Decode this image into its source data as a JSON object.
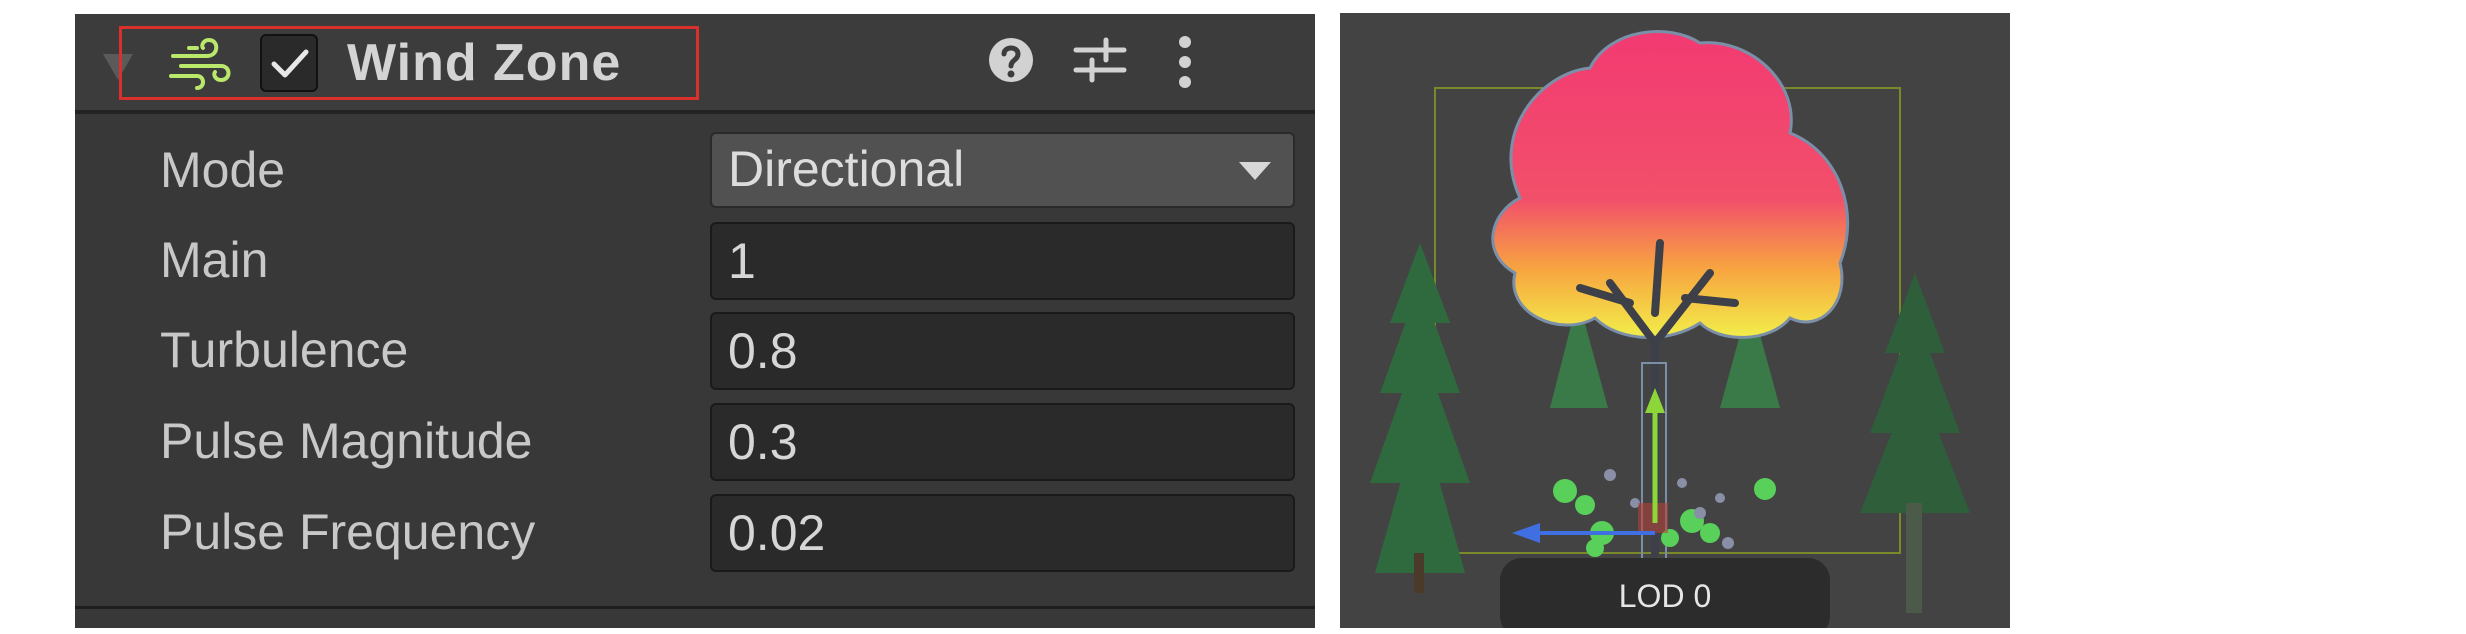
{
  "header": {
    "title": "Wind Zone",
    "enabled": true,
    "icons": [
      "wind-icon",
      "help-icon",
      "presets-icon",
      "more-menu-icon"
    ]
  },
  "properties": [
    {
      "label": "Mode",
      "value": "Directional",
      "type": "dropdown"
    },
    {
      "label": "Main",
      "value": "1",
      "type": "number"
    },
    {
      "label": "Turbulence",
      "value": "0.8",
      "type": "number"
    },
    {
      "label": "Pulse Magnitude",
      "value": "0.3",
      "type": "number"
    },
    {
      "label": "Pulse Frequency",
      "value": "0.02",
      "type": "number"
    }
  ],
  "preview": {
    "lod_label": "LOD 0"
  },
  "colors": {
    "panel_bg": "#383838",
    "header_bg": "#3c3c3c",
    "highlight_outline": "#d9302c",
    "wind_icon": "#b9e86a",
    "field_bg": "#2a2a2a",
    "dropdown_bg": "#515151",
    "preview_bg": "#434343"
  }
}
